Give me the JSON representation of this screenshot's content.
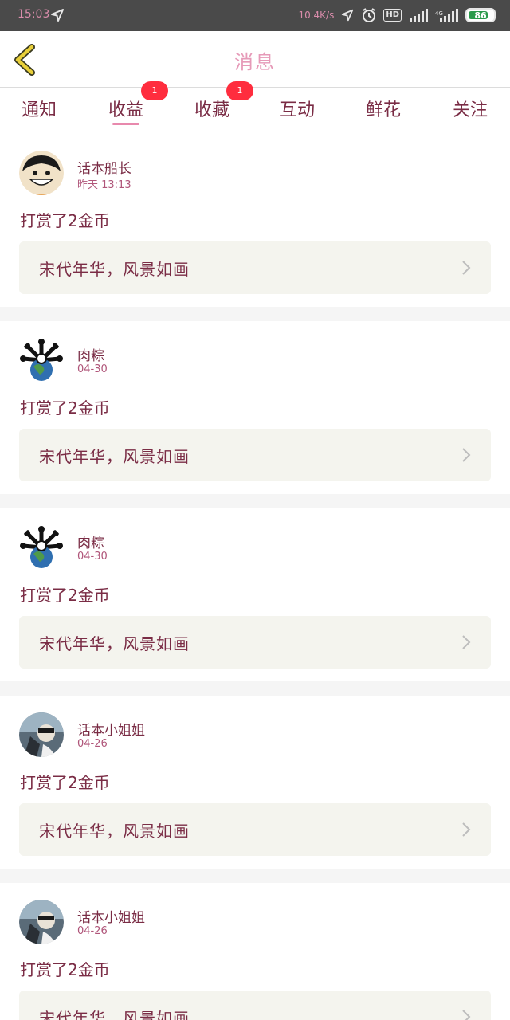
{
  "status_bar": {
    "time": "15:03",
    "speed": "10.4K/s",
    "hd": "HD",
    "battery": "86",
    "icons": [
      "location-arrow-icon",
      "alarm-icon",
      "signal-icon",
      "signal-icon",
      "battery-icon"
    ]
  },
  "header": {
    "title": "消息",
    "back_icon": "chevron-left-icon",
    "accent": "#e69ab8",
    "back_color": "#e8cf3a"
  },
  "tabs": [
    {
      "label": "通知",
      "badge": ""
    },
    {
      "label": "收益",
      "badge": "1",
      "active": true
    },
    {
      "label": "收藏",
      "badge": "1"
    },
    {
      "label": "互动",
      "badge": ""
    },
    {
      "label": "鲜花",
      "badge": ""
    },
    {
      "label": "关注",
      "badge": ""
    }
  ],
  "messages": [
    {
      "name": "话本船长",
      "time": "昨天 13:13",
      "text": "打赏了2金币",
      "link": "宋代年华，风景如画",
      "avatar": "cartoon-avatar"
    },
    {
      "name": "肉粽",
      "time": "04-30",
      "text": "打赏了2金币",
      "link": "宋代年华，风景如画",
      "avatar": "globe-avatar"
    },
    {
      "name": "肉粽",
      "time": "04-30",
      "text": "打赏了2金币",
      "link": "宋代年华，风景如画",
      "avatar": "globe-avatar"
    },
    {
      "name": "话本小姐姐",
      "time": "04-26",
      "text": "打赏了2金币",
      "link": "宋代年华，风景如画",
      "avatar": "photo-avatar"
    },
    {
      "name": "话本小姐姐",
      "time": "04-26",
      "text": "打赏了2金币",
      "link": "宋代年华，风景如画",
      "avatar": "photo-avatar"
    }
  ],
  "colors": {
    "text": "#7a2c45",
    "badge": "#ff2d3e",
    "link_bg": "#f4f4ee",
    "underline": "#e889ad"
  }
}
